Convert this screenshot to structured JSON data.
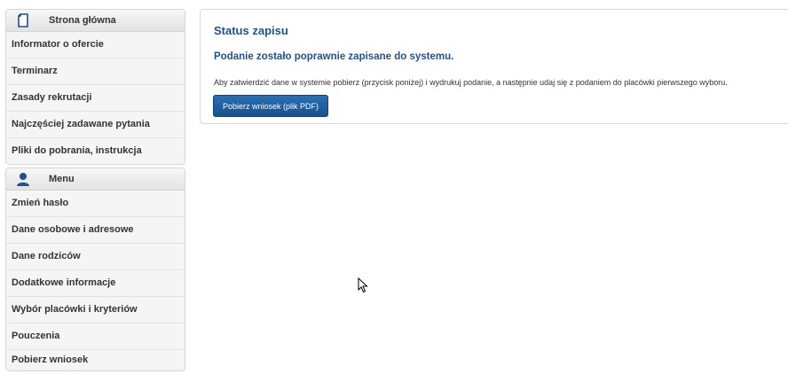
{
  "sidebar": {
    "groups": [
      {
        "title": "Strona główna",
        "icon": "document-icon",
        "items": [
          "Informator o ofercie",
          "Terminarz",
          "Zasady rekrutacji",
          "Najczęściej zadawane pytania",
          "Pliki do pobrania, instrukcja"
        ]
      },
      {
        "title": "Menu",
        "icon": "user-icon",
        "items": [
          "Zmień hasło",
          "Dane osobowe i adresowe",
          "Dane rodziców",
          "Dodatkowe informacje",
          "Wybór placówki i kryteriów",
          "Pouczenia",
          "Pobierz wniosek"
        ]
      }
    ]
  },
  "main": {
    "title": "Status zapisu",
    "subtitle": "Podanie zostało poprawnie zapisane do systemu.",
    "text": "Aby zatwierdzić dane w systemie pobierz (przycisk poniżej) i wydrukuj podanie, a następnie udaj się z podaniem do placówki pierwszego wyboru.",
    "button_label": "Pobierz wniosek (plik PDF)"
  },
  "colors": {
    "accent": "#1d5290",
    "button": "#1f61a3"
  }
}
